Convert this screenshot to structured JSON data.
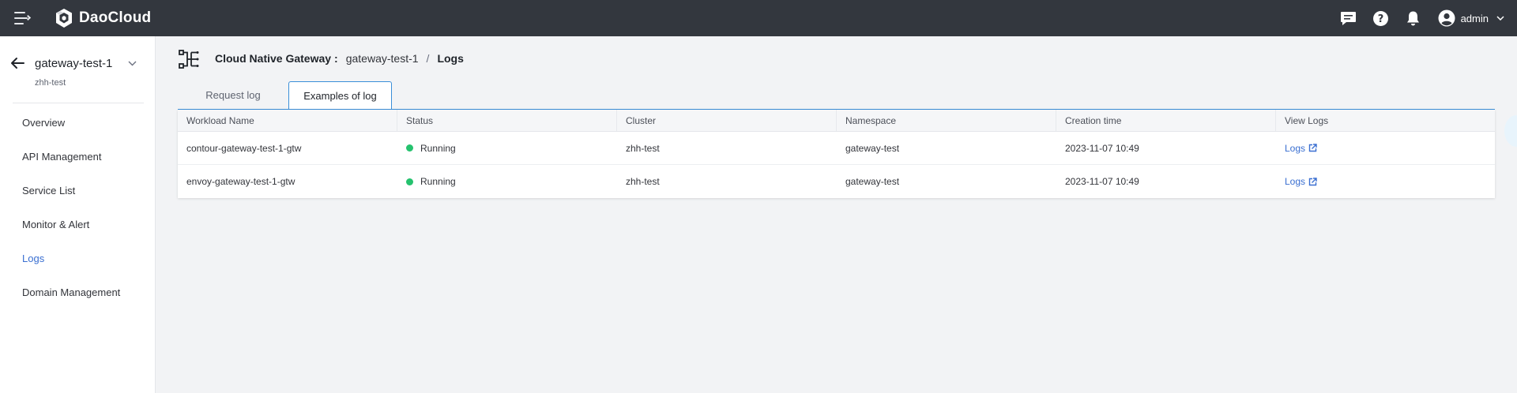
{
  "topbar": {
    "brand": "DaoCloud",
    "user": {
      "name": "admin"
    },
    "icons": [
      "message-icon",
      "help-icon",
      "bell-icon",
      "user-avatar-icon"
    ]
  },
  "sidebar": {
    "gateway_name": "gateway-test-1",
    "gateway_sub": "zhh-test",
    "items": [
      {
        "label": "Overview",
        "active": false
      },
      {
        "label": "API Management",
        "active": false
      },
      {
        "label": "Service List",
        "active": false
      },
      {
        "label": "Monitor & Alert",
        "active": false
      },
      {
        "label": "Logs",
        "active": true
      },
      {
        "label": "Domain Management",
        "active": false
      }
    ]
  },
  "breadcrumb": {
    "module": "Cloud Native Gateway",
    "colon": ":",
    "gateway": "gateway-test-1",
    "separator": "/",
    "current": "Logs"
  },
  "tabs": [
    {
      "label": "Request log",
      "active": false
    },
    {
      "label": "Examples of log",
      "active": true
    }
  ],
  "table": {
    "columns": [
      "Workload Name",
      "Status",
      "Cluster",
      "Namespace",
      "Creation time",
      "View Logs"
    ],
    "rows": [
      {
        "workload": "contour-gateway-test-1-gtw",
        "status": "Running",
        "cluster": "zhh-test",
        "namespace": "gateway-test",
        "created": "2023-11-07 10:49",
        "view": "Logs"
      },
      {
        "workload": "envoy-gateway-test-1-gtw",
        "status": "Running",
        "cluster": "zhh-test",
        "namespace": "gateway-test",
        "created": "2023-11-07 10:49",
        "view": "Logs"
      }
    ]
  },
  "colors": {
    "topbar": "#33373e",
    "accent": "#3a6fd1",
    "running": "#25c26e",
    "tab_border": "#3a8ed8"
  }
}
